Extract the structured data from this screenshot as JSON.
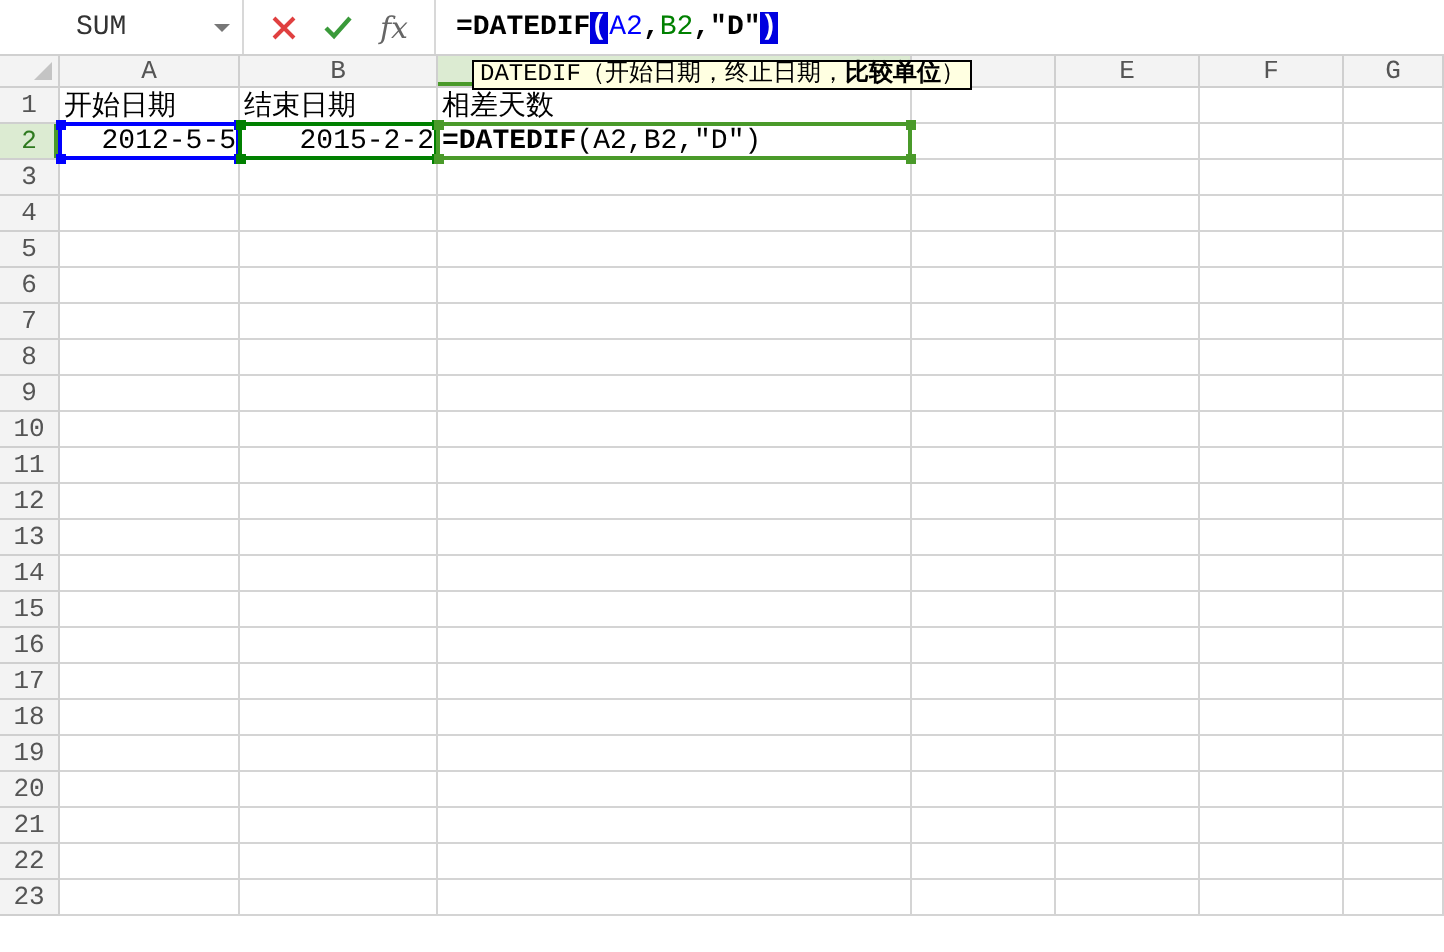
{
  "name_box": {
    "value": "SUM"
  },
  "function_button": {
    "label": "fx"
  },
  "formula": [
    {
      "kind": "text",
      "text": "=DATEDIF"
    },
    {
      "kind": "bracket",
      "text": "("
    },
    {
      "kind": "ref",
      "text": "A2",
      "color": "#0000ff"
    },
    {
      "kind": "text",
      "text": ","
    },
    {
      "kind": "ref",
      "text": "B2",
      "color": "#008000"
    },
    {
      "kind": "text",
      "text": ",\"D\""
    },
    {
      "kind": "bracket",
      "text": ")"
    }
  ],
  "columns": [
    {
      "label": "A",
      "selected": false
    },
    {
      "label": "B",
      "selected": false
    },
    {
      "selected": true
    },
    {
      "selected": false
    },
    {
      "label": "E",
      "selected": false
    },
    {
      "label": "F",
      "selected": false
    },
    {
      "label": "G",
      "selected": false
    }
  ],
  "rows": [
    {
      "label": "1",
      "selected": false,
      "cells": [
        {
          "kind": "text",
          "text": "开始日期"
        },
        {
          "kind": "text",
          "text": "结束日期"
        },
        {
          "kind": "text",
          "text": "相差天数"
        }
      ]
    },
    {
      "label": "2",
      "selected": true,
      "cells": [
        {
          "kind": "number",
          "text": "2012-5-5",
          "color": "#0000ff"
        },
        {
          "kind": "number",
          "text": "2015-2-2",
          "color": "#008000"
        },
        {
          "kind": "formula",
          "text": "**=DATEDIF**(A2,B2,\"D\")",
          "color": "#4a9a2a"
        }
      ]
    },
    {
      "label": "3",
      "selected": false
    },
    {
      "label": "4",
      "selected": false
    },
    {
      "label": "5",
      "selected": false
    },
    {
      "label": "6",
      "selected": false
    },
    {
      "label": "7",
      "selected": false
    },
    {
      "label": "8",
      "selected": false
    },
    {
      "label": "9",
      "selected": false
    },
    {
      "label": "10",
      "selected": false
    },
    {
      "label": "11",
      "selected": false
    },
    {
      "label": "12",
      "selected": false
    },
    {
      "label": "13",
      "selected": false
    },
    {
      "label": "14",
      "selected": false
    },
    {
      "label": "15",
      "selected": false
    },
    {
      "label": "16",
      "selected": false
    },
    {
      "label": "17",
      "selected": false
    },
    {
      "label": "18",
      "selected": false
    },
    {
      "label": "19",
      "selected": false
    },
    {
      "label": "20",
      "selected": false
    },
    {
      "label": "21",
      "selected": false
    },
    {
      "label": "22",
      "selected": false
    },
    {
      "label": "23",
      "selected": false
    }
  ],
  "tooltip": {
    "text": "DATEDIF（开始日期，终止日期，**比较单位**）"
  }
}
